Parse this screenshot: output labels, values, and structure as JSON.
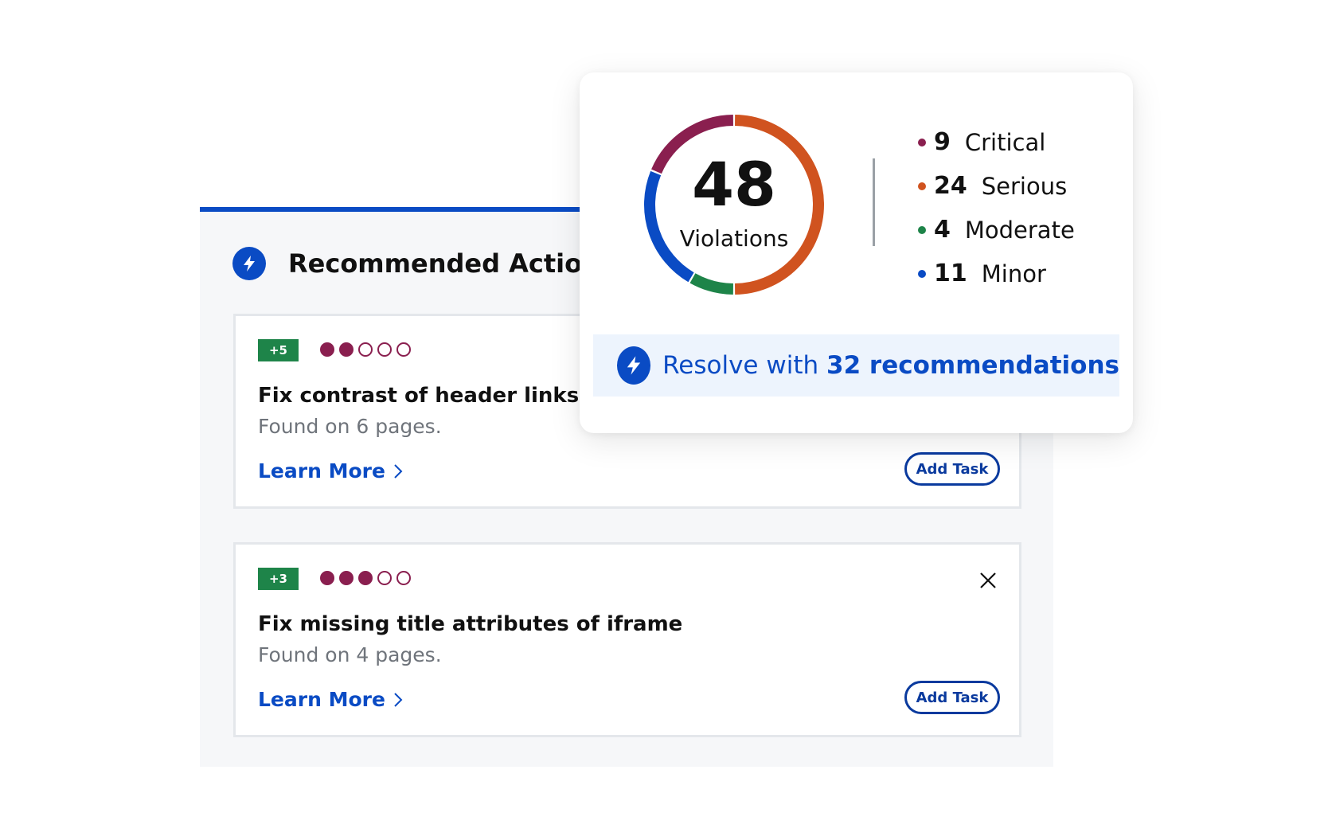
{
  "panel": {
    "title": "Recommended Action",
    "accent_color": "#0a4bc4",
    "icon": "lightning-bolt-icon"
  },
  "cards": [
    {
      "score": "+5",
      "severity_level": 2,
      "severity_max": 5,
      "title": "Fix contrast of header links",
      "subtitle": "Found on 6 pages.",
      "learn_more": "Learn More",
      "add_task": "Add Task",
      "dismissible": false
    },
    {
      "score": "+3",
      "severity_level": 3,
      "severity_max": 5,
      "title": "Fix missing title attributes of iframe",
      "subtitle": "Found on 4 pages.",
      "learn_more": "Learn More",
      "add_task": "Add Task",
      "dismissible": true
    }
  ],
  "summary": {
    "total": "48",
    "total_label": "Violations",
    "legend": [
      {
        "count": "9",
        "label": "Critical",
        "color": "#8a1f4f"
      },
      {
        "count": "24",
        "label": "Serious",
        "color": "#d0531f"
      },
      {
        "count": "4",
        "label": "Moderate",
        "color": "#1e8449"
      },
      {
        "count": "11",
        "label": "Minor",
        "color": "#0a4bc4"
      }
    ],
    "resolve_prefix": "Resolve with ",
    "resolve_strong": "32 recommendations"
  },
  "colors": {
    "score_badge": "#1e8449",
    "severity_dot": "#8a1f4f",
    "link": "#0a4bc4",
    "resolve_bg": "#edf4fd"
  }
}
